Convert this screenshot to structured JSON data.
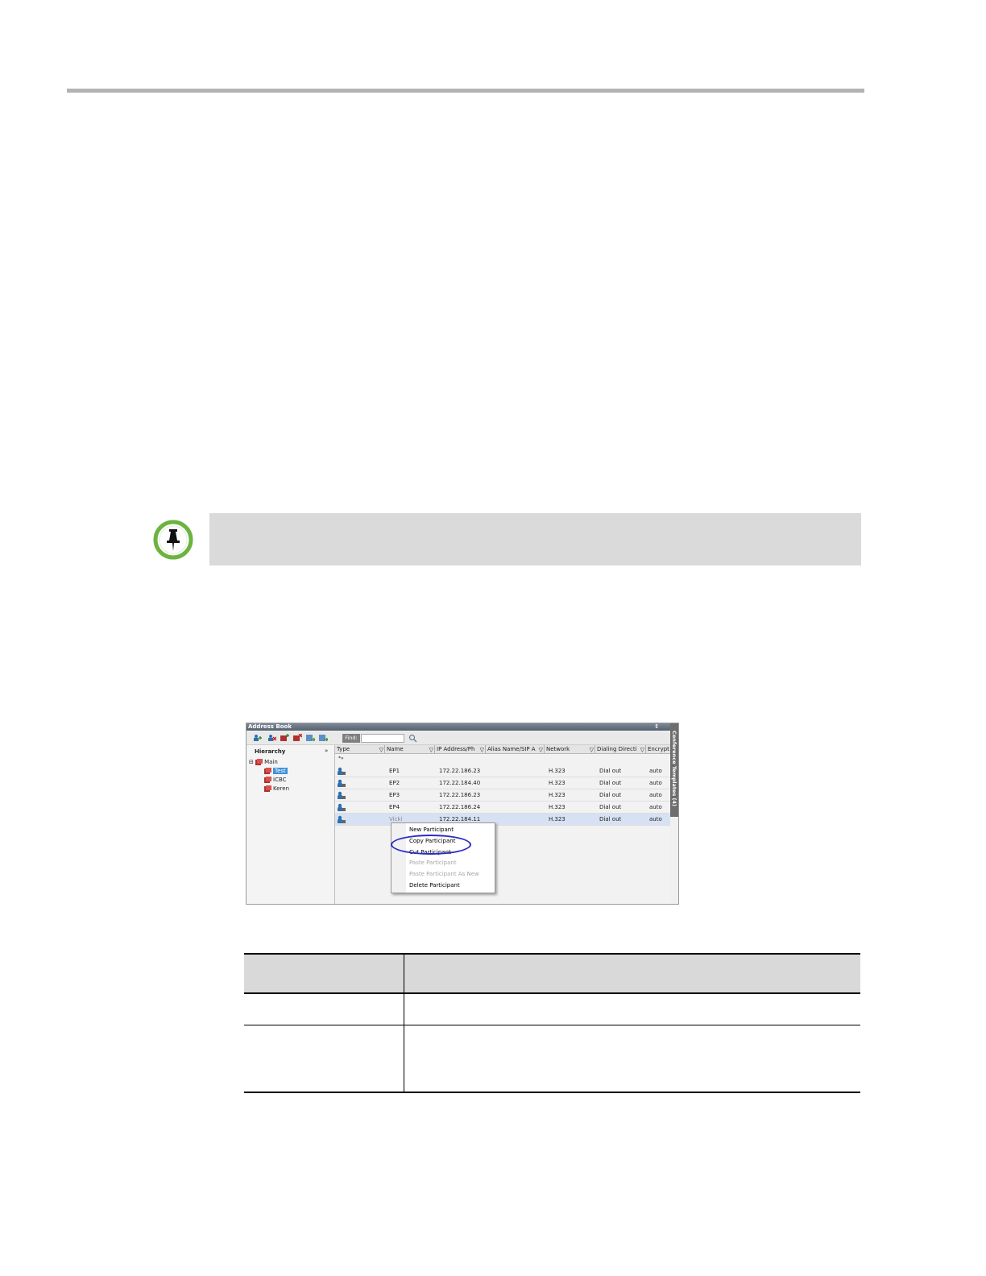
{
  "address_book": {
    "title": "Address Book",
    "title_button": "↕",
    "find_label": "Find:",
    "find_value": "",
    "hierarchy_label": "Hierarchy",
    "collapse_glyph": "»",
    "side_tab": "Conference Templates (4)",
    "tree": [
      {
        "label": "Main",
        "expander": "⊟"
      },
      {
        "label": "Test",
        "selected": true
      },
      {
        "label": "ICBC"
      },
      {
        "label": "Keren"
      }
    ],
    "columns": [
      "Type",
      "Name",
      "IP Address/Ph",
      "Alias Name/SIP A",
      "Network",
      "Dialing Directi",
      "Encrypt"
    ],
    "new_row_marker": "*»",
    "rows": [
      {
        "name": "EP1",
        "ip": "172.22.186.23",
        "alias": "",
        "network": "H.323",
        "dialing": "Dial out",
        "encrypt": "auto"
      },
      {
        "name": "EP2",
        "ip": "172.22.184.40",
        "alias": "",
        "network": "H.323",
        "dialing": "Dial out",
        "encrypt": "auto"
      },
      {
        "name": "EP3",
        "ip": "172.22.186.23",
        "alias": "",
        "network": "H.323",
        "dialing": "Dial out",
        "encrypt": "auto"
      },
      {
        "name": "EP4",
        "ip": "172.22.186.24",
        "alias": "",
        "network": "H.323",
        "dialing": "Dial out",
        "encrypt": "auto"
      },
      {
        "name": "Vicki",
        "ip": "172.22.184.11",
        "alias": "",
        "network": "H.323",
        "dialing": "Dial out",
        "encrypt": "auto"
      }
    ],
    "context_menu": [
      {
        "label": "New Participant",
        "enabled": true
      },
      {
        "label": "Copy Participant",
        "enabled": true
      },
      {
        "label": "Cut Participant",
        "enabled": true
      },
      {
        "label": "Paste Participant",
        "enabled": false
      },
      {
        "label": "Paste Participant As New",
        "enabled": false
      },
      {
        "label": "Delete Participant",
        "enabled": true
      }
    ]
  },
  "colors": {
    "rule": "#b3b3b3",
    "note_box": "#dadada",
    "note_icon_ring": "#6cb33f",
    "highlight_ellipse": "#2b2bc4",
    "table_header": "#d9d9d9"
  }
}
